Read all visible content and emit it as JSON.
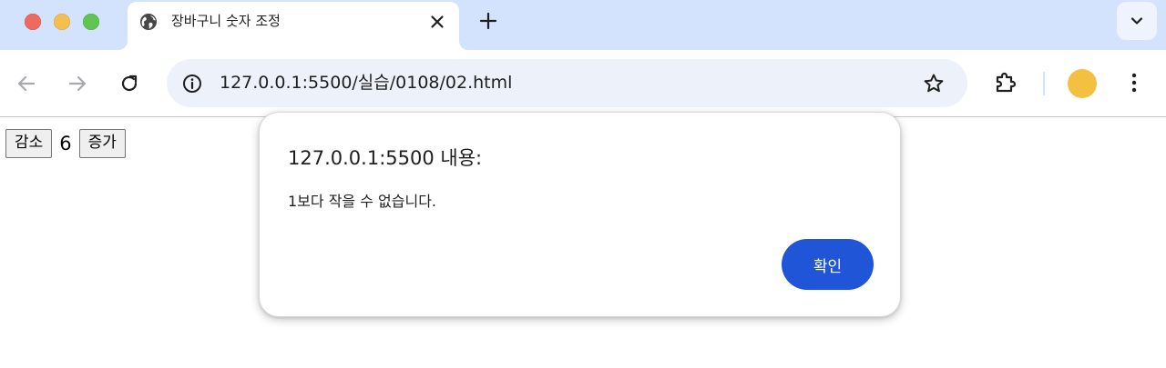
{
  "window": {
    "controls": [
      "close",
      "minimize",
      "zoom"
    ]
  },
  "tab": {
    "title": "장바구니 숫자 조정",
    "favicon": "globe-icon",
    "close_icon": "close-icon"
  },
  "new_tab_icon": "plus-icon",
  "tab_search_icon": "chevron-down-icon",
  "toolbar": {
    "back_icon": "arrow-left-icon",
    "forward_icon": "arrow-right-icon",
    "reload_icon": "reload-icon",
    "site_info_icon": "info-icon",
    "url": "127.0.0.1:5500/실습/0108/02.html",
    "bookmark_icon": "star-icon",
    "extensions_icon": "puzzle-icon",
    "menu_icon": "kebab-menu-icon",
    "profile_color": "#f4c042"
  },
  "page": {
    "decrease_label": "감소",
    "count": "6",
    "increase_label": "증가"
  },
  "dialog": {
    "title": "127.0.0.1:5500 내용:",
    "message": "1보다 작을 수 없습니다.",
    "ok_label": "확인",
    "ok_color": "#1f55d6"
  }
}
